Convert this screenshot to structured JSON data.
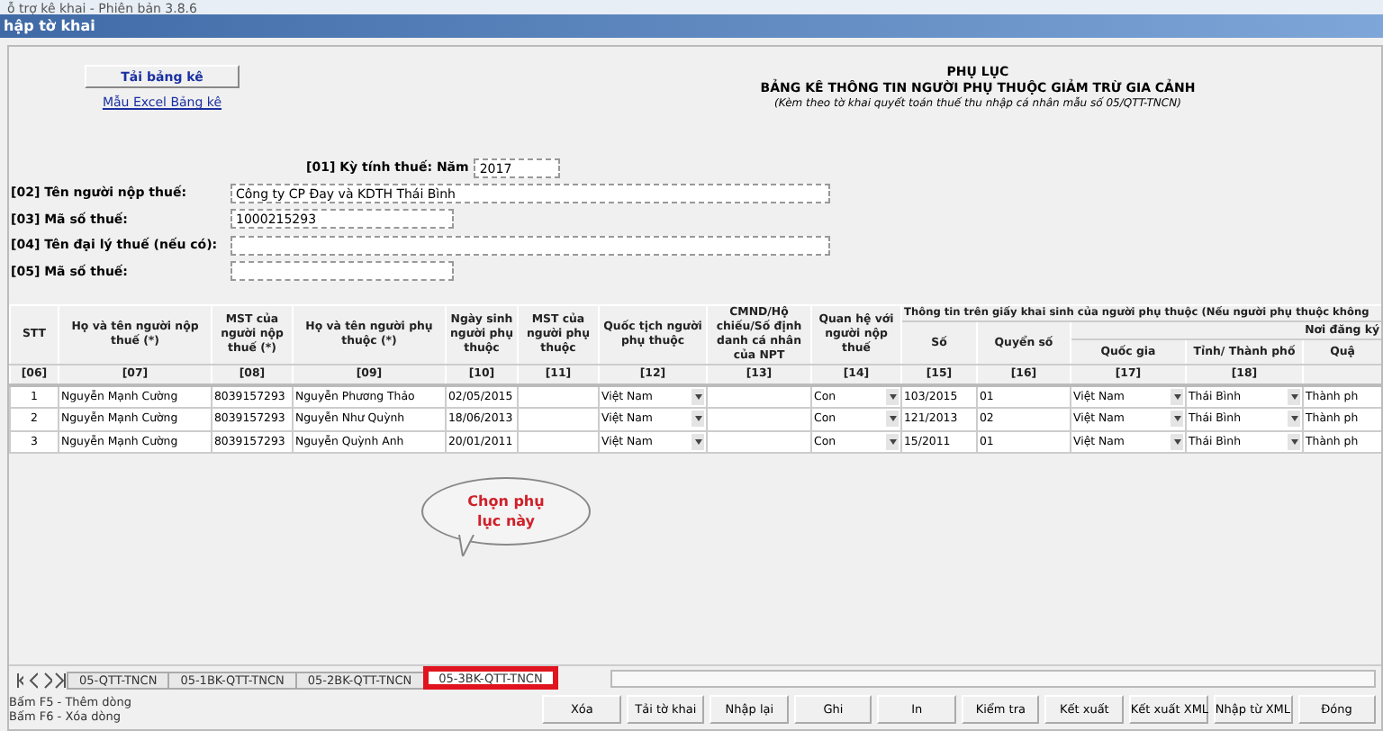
{
  "window": {
    "title": "ỗ trợ kê khai - Phiên bản 3.8.6",
    "subtitle": "hập tờ khai"
  },
  "form": {
    "load_button": "Tải bảng kê",
    "excel_link": "Mẫu Excel Bảng kê",
    "heading": "PHỤ LỤC",
    "title": "BẢNG KÊ THÔNG TIN NGƯỜI PHỤ THUỘC GIẢM TRỪ GIA CẢNH",
    "note": "(Kèm theo tờ khai quyết toán thuế thu nhập cá nhân mẫu số 05/QTT-TNCN)",
    "period": {
      "label": "[01] Kỳ tính thuế: Năm",
      "value": "2017"
    },
    "fields": [
      {
        "label": "[02] Tên người nộp thuế:",
        "value": "Công ty CP Đay và KDTH Thái Bình",
        "wide": true
      },
      {
        "label": "[03] Mã số thuế:",
        "value": "1000215293",
        "wide": false
      },
      {
        "label": "[04] Tên đại lý thuế (nếu có):",
        "wide": true
      },
      {
        "label": "[05] Mã số thuế:",
        "wide": false
      }
    ]
  },
  "table": {
    "headers": [
      "STT",
      "Họ và tên người nộp thuế (*)",
      "MST của người nộp thuế (*)",
      "Họ và tên người phụ thuộc (*)",
      "Ngày sinh người phụ thuộc",
      "MST của người phụ thuộc",
      "Quốc tịch người phụ thuộc",
      "CMND/Hộ chiếu/Số định danh cá nhân của NPT",
      "Quan hệ với người nộp thuế"
    ],
    "group": "Thông tin trên giấy khai sinh của người phụ thuộc (Nếu người phụ thuộc không",
    "subheaders": [
      "Số",
      "Quyển số"
    ],
    "subgroup": "Nơi đăng ký",
    "leaf_headers": [
      "Quốc gia",
      "Tỉnh/ Thành phố",
      "Quậ"
    ],
    "codes": [
      "[06]",
      "[07]",
      "[08]",
      "[09]",
      "[10]",
      "[11]",
      "[12]",
      "[13]",
      "[14]",
      "[15]",
      "[16]",
      "[17]",
      "[18]"
    ],
    "rows": [
      {
        "cells": [
          {
            "kind": "center",
            "text": "1"
          },
          {
            "kind": "text",
            "text": "Nguyễn Mạnh Cường"
          },
          {
            "kind": "text",
            "text": "8039157293"
          },
          {
            "kind": "text",
            "text": "Nguyễn Phương Thảo"
          },
          {
            "kind": "text",
            "text": "02/05/2015"
          },
          {
            "kind": "text"
          },
          {
            "kind": "select",
            "text": "Việt Nam"
          },
          {
            "kind": "text"
          },
          {
            "kind": "select",
            "text": "Con"
          },
          {
            "kind": "text",
            "text": "103/2015"
          },
          {
            "kind": "text",
            "text": "01"
          },
          {
            "kind": "select",
            "text": "Việt Nam"
          },
          {
            "kind": "select",
            "text": "Thái Bình"
          },
          {
            "kind": "text",
            "text": "Thành ph"
          }
        ]
      },
      {
        "cells": [
          {
            "kind": "center",
            "text": "2"
          },
          {
            "kind": "text",
            "text": "Nguyễn Mạnh Cường"
          },
          {
            "kind": "text",
            "text": "8039157293"
          },
          {
            "kind": "text",
            "text": "Nguyễn Như Quỳnh"
          },
          {
            "kind": "text",
            "text": "18/06/2013"
          },
          {
            "kind": "text"
          },
          {
            "kind": "select",
            "text": "Việt Nam"
          },
          {
            "kind": "text"
          },
          {
            "kind": "select",
            "text": "Con"
          },
          {
            "kind": "text",
            "text": "121/2013"
          },
          {
            "kind": "text",
            "text": "02"
          },
          {
            "kind": "select",
            "text": "Việt Nam"
          },
          {
            "kind": "select",
            "text": "Thái Bình"
          },
          {
            "kind": "text",
            "text": "Thành ph"
          }
        ]
      },
      {
        "cells": [
          {
            "kind": "center",
            "text": "3"
          },
          {
            "kind": "text",
            "text": "Nguyễn Mạnh Cường"
          },
          {
            "kind": "text",
            "text": "8039157293"
          },
          {
            "kind": "text",
            "text": "Nguyễn Quỳnh Anh"
          },
          {
            "kind": "text",
            "text": "20/01/2011"
          },
          {
            "kind": "text"
          },
          {
            "kind": "select",
            "text": "Việt Nam"
          },
          {
            "kind": "text"
          },
          {
            "kind": "select",
            "text": "Con"
          },
          {
            "kind": "text",
            "text": "15/2011"
          },
          {
            "kind": "text",
            "text": "01"
          },
          {
            "kind": "select",
            "text": "Việt Nam"
          },
          {
            "kind": "select",
            "text": "Thái Bình"
          },
          {
            "kind": "text",
            "text": "Thành ph"
          }
        ]
      }
    ]
  },
  "callout": "Chọn phụ lục này",
  "sheet_tabs": [
    {
      "label": "05-QTT-TNCN",
      "selected": false,
      "highlighted": false
    },
    {
      "label": "05-1BK-QTT-TNCN",
      "selected": false,
      "highlighted": false
    },
    {
      "label": "05-2BK-QTT-TNCN",
      "selected": false,
      "highlighted": false
    },
    {
      "label": "05-3BK-QTT-TNCN",
      "selected": true,
      "highlighted": true
    }
  ],
  "status_lines": [
    "Bấm F5 - Thêm dòng",
    "Bấm F6 - Xóa dòng"
  ],
  "buttons": [
    "Xóa",
    "Tải tờ khai",
    "Nhập lại",
    "Ghi",
    "In",
    "Kiểm tra",
    "Kết xuất",
    "Kết xuất XML",
    "Nhập từ XML",
    "Đóng"
  ]
}
